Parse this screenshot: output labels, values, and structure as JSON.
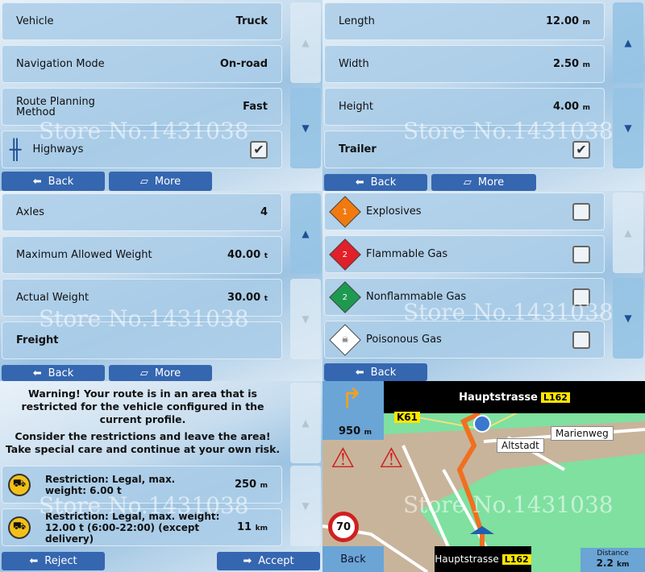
{
  "watermark": "Store No.1431038",
  "panel1": {
    "rows": [
      {
        "label": "Vehicle",
        "value": "Truck"
      },
      {
        "label": "Navigation Mode",
        "value": "On-road"
      },
      {
        "label": "Route Planning Method",
        "value": "Fast"
      },
      {
        "label": "Highways",
        "checked": true,
        "icon": "highway-icon"
      }
    ],
    "back": "Back",
    "more": "More"
  },
  "panel2": {
    "rows": [
      {
        "label": "Length",
        "value": "12.00",
        "unit": "m"
      },
      {
        "label": "Width",
        "value": "2.50",
        "unit": "m"
      },
      {
        "label": "Height",
        "value": "4.00",
        "unit": "m"
      },
      {
        "label": "Trailer",
        "checked": true
      }
    ],
    "back": "Back",
    "more": "More"
  },
  "panel3": {
    "rows": [
      {
        "label": "Axles",
        "value": "4"
      },
      {
        "label": "Maximum Allowed Weight",
        "value": "40.00",
        "unit": "t"
      },
      {
        "label": "Actual Weight",
        "value": "30.00",
        "unit": "t"
      },
      {
        "label": "Freight"
      }
    ],
    "back": "Back",
    "more": "More"
  },
  "panel4": {
    "rows": [
      {
        "label": "Explosives",
        "checked": false,
        "color": "#f07a10"
      },
      {
        "label": "Flammable Gas",
        "checked": false,
        "color": "#e0202a"
      },
      {
        "label": "Nonflammable Gas",
        "checked": false,
        "color": "#1e9a50"
      },
      {
        "label": "Poisonous Gas",
        "checked": false,
        "color": "#ffffff"
      }
    ],
    "back": "Back"
  },
  "panel5": {
    "warning": "Warning! Your route is in an area that is restricted for the vehicle configured in the current profile.",
    "advice": "Consider the restrictions and leave the area! Take special care and continue at your own risk.",
    "restrictions": [
      {
        "text": "Restriction: Legal, max. weight: 6.00 t",
        "dist": "250",
        "unit": "m"
      },
      {
        "text": "Restriction: Legal, max. weight: 12.00 t (6:00-22:00) (except delivery)",
        "dist": "11",
        "unit": "km"
      }
    ],
    "reject": "Reject",
    "accept": "Accept"
  },
  "map": {
    "street": "Hauptstrasse",
    "road": "L162",
    "turn_dist": "950",
    "turn_unit": "m",
    "k_road": "K61",
    "places": [
      "Altstadt",
      "Marienweg"
    ],
    "speed_limit": "70",
    "back": "Back",
    "distance_label": "Distance",
    "distance": "2.2",
    "distance_unit": "km",
    "route_color": "#f07020"
  }
}
